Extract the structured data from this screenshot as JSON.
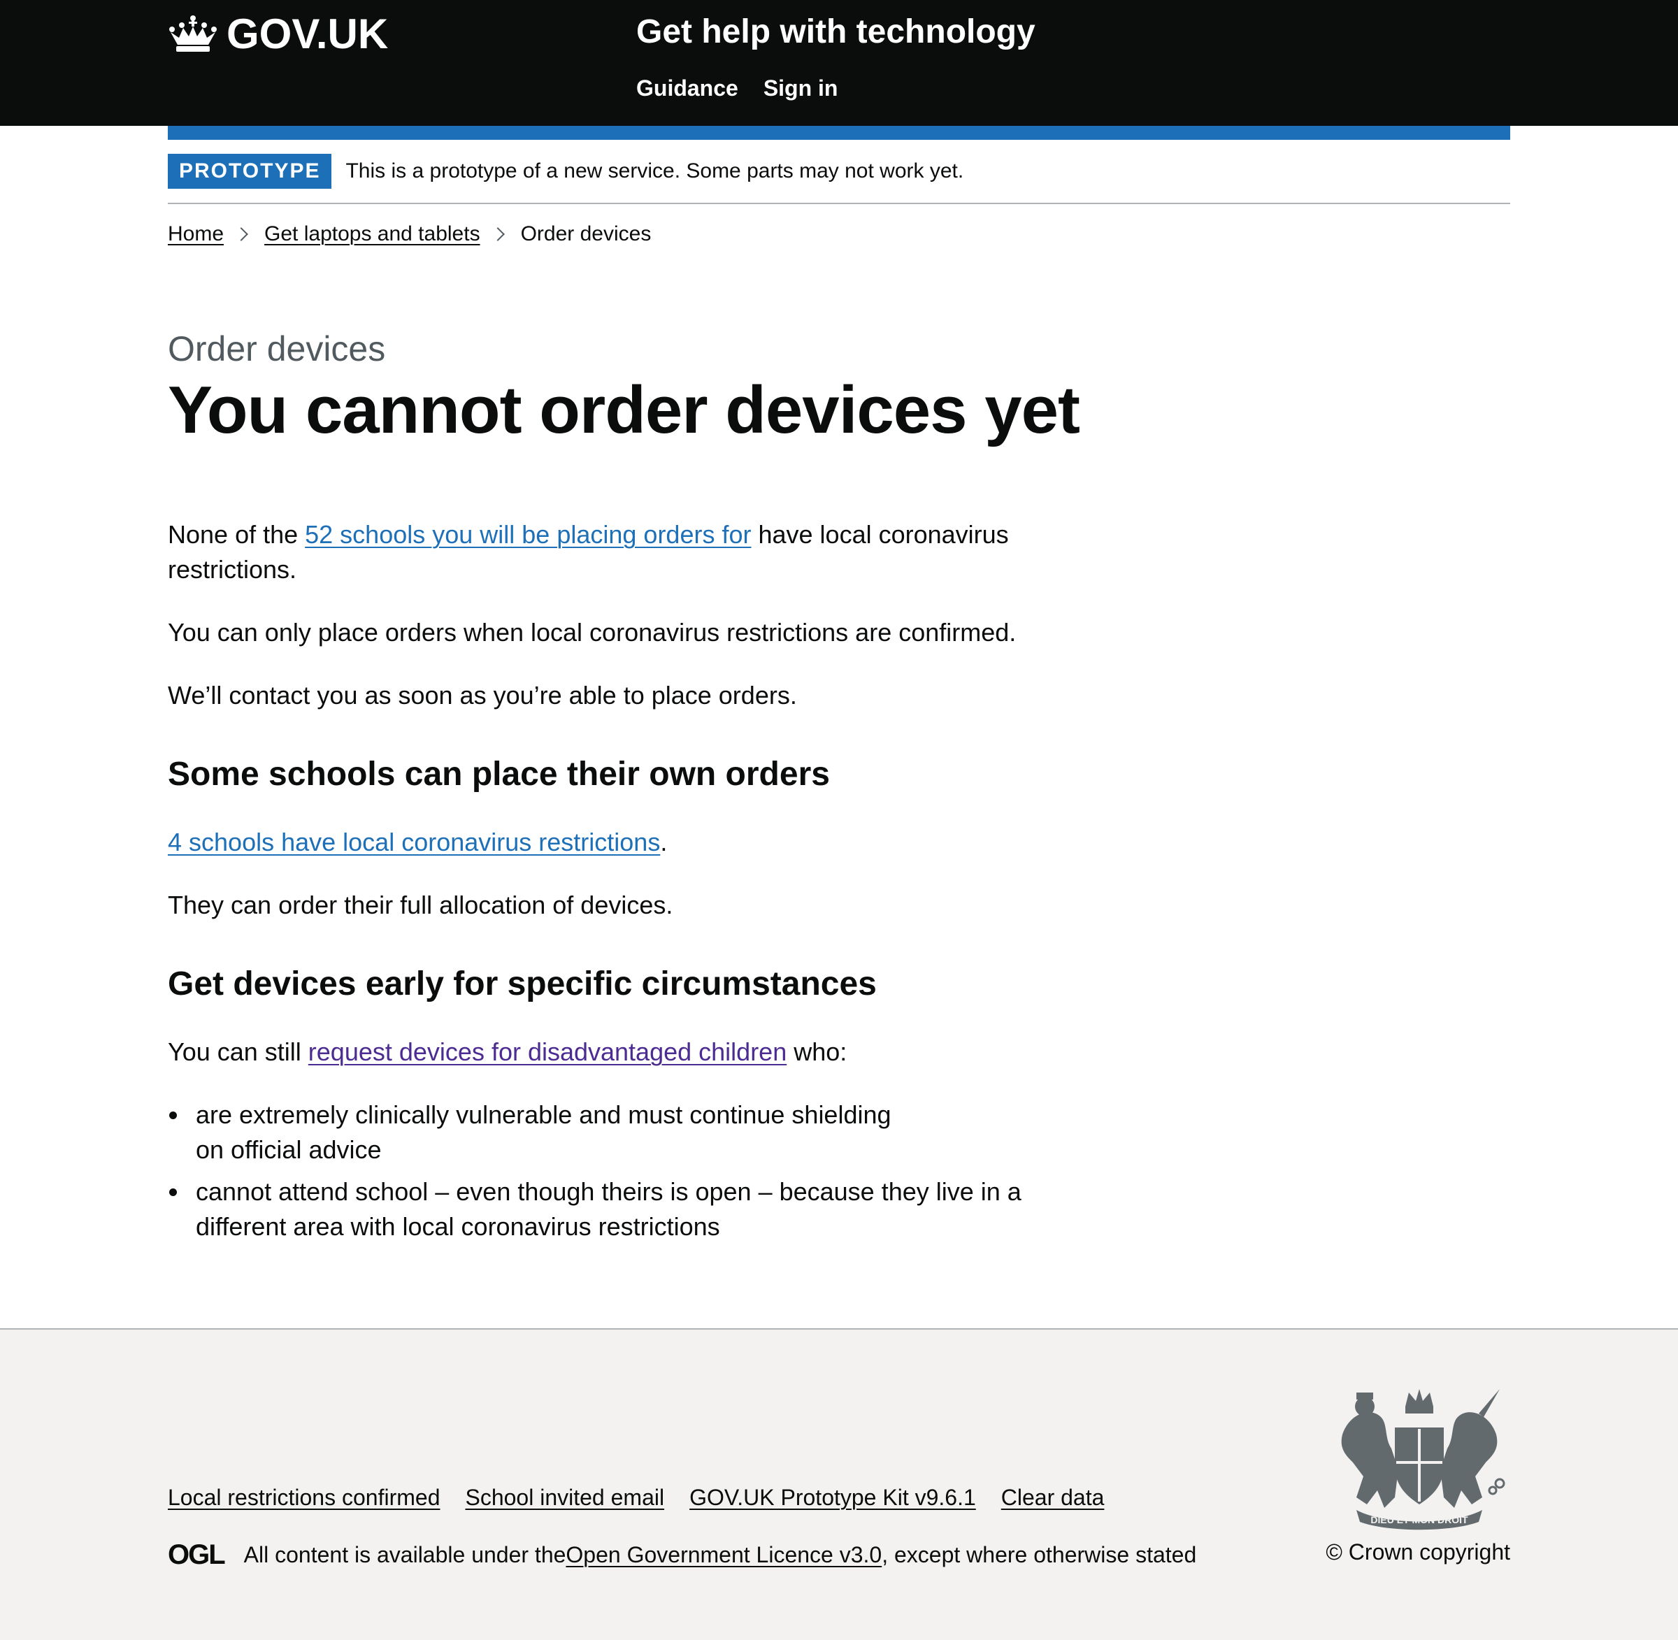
{
  "header": {
    "logo_text": "GOV.UK",
    "service_name": "Get help with technology",
    "nav": [
      {
        "label": "Guidance"
      },
      {
        "label": "Sign in"
      }
    ]
  },
  "phase_banner": {
    "tag": "PROTOTYPE",
    "text": "This is a prototype of a new service. Some parts may not work yet."
  },
  "breadcrumb": [
    {
      "label": "Home"
    },
    {
      "label": "Get laptops and tablets"
    },
    {
      "label": "Order devices"
    }
  ],
  "main": {
    "caption": "Order devices",
    "title": "You cannot order devices yet",
    "p1_before": "None of the ",
    "p1_link": "52 schools you will be placing orders for",
    "p1_after": " have local coronavirus restrictions.",
    "p2": "You can only place orders when local coronavirus restrictions are confirmed.",
    "p3": "We’ll contact you as soon as you’re able to place orders.",
    "h2_own_orders": "Some schools can place their own orders",
    "p4_link": "4 schools have local coronavirus restrictions",
    "p4_after": ".",
    "p5": "They can order their full allocation of devices.",
    "h2_early": "Get devices early for specific circumstances",
    "p6_before": "You can still ",
    "p6_link": "request devices for disadvantaged children",
    "p6_after": " who:",
    "bullets": [
      "are extremely clinically vulnerable and must continue shielding on official advice",
      "cannot attend school – even though theirs is open – because they live in a different area with local coronavirus restrictions"
    ]
  },
  "footer": {
    "links": [
      {
        "label": "Local restrictions confirmed"
      },
      {
        "label": "School invited email"
      },
      {
        "label": "GOV.UK Prototype Kit v9.6.1"
      },
      {
        "label": "Clear data"
      }
    ],
    "ogl_logo": "OGL",
    "licence_before": "All content is available under the ",
    "licence_link": "Open Government Licence v3.0",
    "licence_after": ", except where otherwise stated",
    "copyright": "© Crown copyright",
    "crest_motto": "DIEU ET MON DROIT"
  },
  "colors": {
    "header_bg": "#0b0c0c",
    "brand_blue": "#1d70b8",
    "link": "#1d70b8",
    "visited_link": "#4c2c92",
    "footer_bg": "#f3f2f1",
    "secondary_text": "#505a5f"
  }
}
